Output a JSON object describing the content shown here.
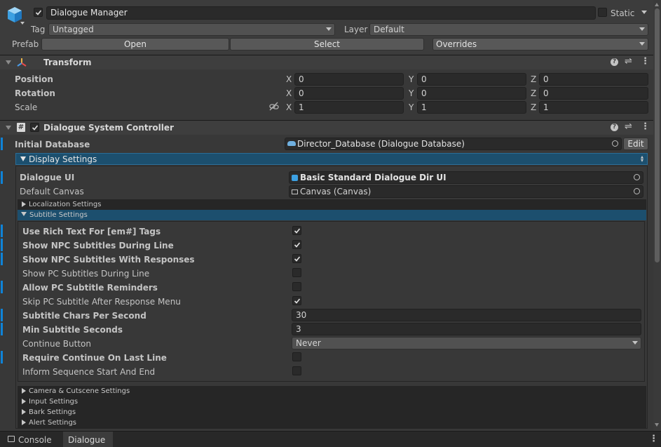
{
  "header": {
    "object_name": "Dialogue Manager",
    "static_label": "Static",
    "tag_label": "Tag",
    "tag_value": "Untagged",
    "layer_label": "Layer",
    "layer_value": "Default",
    "prefab_label": "Prefab",
    "open_label": "Open",
    "select_label": "Select",
    "overrides_label": "Overrides"
  },
  "transform": {
    "title": "Transform",
    "rows": [
      {
        "label": "Position",
        "x": "0",
        "y": "0",
        "z": "0"
      },
      {
        "label": "Rotation",
        "x": "0",
        "y": "0",
        "z": "0"
      },
      {
        "label": "Scale",
        "x": "1",
        "y": "1",
        "z": "1"
      }
    ],
    "axis_x": "X",
    "axis_y": "Y",
    "axis_z": "Z"
  },
  "controller": {
    "title": "Dialogue System Controller",
    "initial_database_label": "Initial Database",
    "initial_database_value": "Director_Database (Dialogue Database)",
    "edit_label": "Edit",
    "display_settings_label": "Display Settings",
    "dialogue_ui_label": "Dialogue UI",
    "dialogue_ui_value": "Basic Standard Dialogue Dir UI",
    "default_canvas_label": "Default Canvas",
    "default_canvas_value": "Canvas (Canvas)",
    "localization_label": "Localization Settings",
    "subtitle_settings_label": "Subtitle Settings",
    "subtitle_rows": [
      {
        "label": "Use Rich Text For [em#] Tags",
        "checked": true,
        "bold": true,
        "blue": true
      },
      {
        "label": "Show NPC Subtitles During Line",
        "checked": true,
        "bold": true,
        "blue": true
      },
      {
        "label": "Show NPC Subtitles With Responses",
        "checked": true,
        "bold": true,
        "blue": true
      },
      {
        "label": "Show PC Subtitles During Line",
        "checked": false,
        "bold": false,
        "blue": false
      },
      {
        "label": "Allow PC Subtitle Reminders",
        "checked": false,
        "bold": true,
        "blue": true
      },
      {
        "label": "Skip PC Subtitle After Response Menu",
        "checked": true,
        "bold": false,
        "blue": false
      }
    ],
    "chars_per_second_label": "Subtitle Chars Per Second",
    "chars_per_second_value": "30",
    "min_seconds_label": "Min Subtitle Seconds",
    "min_seconds_value": "3",
    "continue_button_label": "Continue Button",
    "continue_button_value": "Never",
    "require_continue_label": "Require Continue On Last Line",
    "inform_sequence_label": "Inform Sequence Start And End",
    "collapsed_sections": [
      "Camera & Cutscene Settings",
      "Input Settings",
      "Bark Settings",
      "Alert Settings"
    ]
  },
  "bottom_tabs": [
    "Console",
    "Dialogue"
  ],
  "colors": {
    "accent_blue": "#0f83d8",
    "selected_row": "#1c4f6e",
    "panel": "#383838"
  }
}
